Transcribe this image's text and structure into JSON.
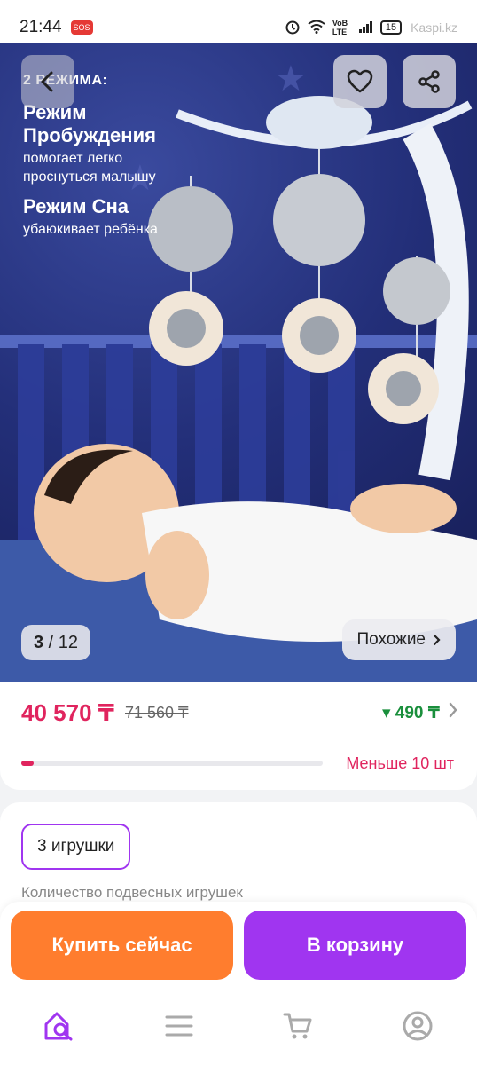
{
  "status_bar": {
    "time": "21:44",
    "sos": "SOS",
    "network": "VoB LTE",
    "battery": "15",
    "watermark": "Kaspi.kz",
    "icons": [
      "alarm-icon",
      "wifi-icon",
      "signal-icon",
      "battery-icon"
    ]
  },
  "gallery": {
    "image_text": {
      "heading": "2 РЕЖИМА:",
      "mode1_title": "Режим Пробуждения",
      "mode1_desc": "помогает легко проснуться малышу",
      "mode2_title": "Режим Сна",
      "mode2_desc": "убаюкивает ребёнка"
    },
    "counter_current": "3",
    "counter_separator": " / ",
    "counter_total": "12",
    "similar_label": "Похожие",
    "icons": [
      "back-icon",
      "heart-icon",
      "share-icon",
      "chevron-right-icon"
    ]
  },
  "price": {
    "current": "40 570 ₸",
    "old": "71 560 ₸",
    "bonus": "▾ 490 ₸",
    "stock_label": "Меньше 10 шт",
    "stock_level_percent": 4
  },
  "options": {
    "selected_chip": "3 игрушки",
    "caption": "Количество подвесных игрушек"
  },
  "actions": {
    "buy_now": "Купить сейчас",
    "add_to_cart": "В корзину"
  },
  "bottom_nav": {
    "items": [
      "home-search-icon",
      "menu-icon",
      "cart-icon",
      "profile-icon"
    ],
    "active_color": "#a035f0"
  },
  "colors": {
    "accent_pink": "#e0245e",
    "buy_orange": "#ff7d2e",
    "cart_purple": "#a035f0",
    "bonus_green": "#1a8f3c"
  }
}
